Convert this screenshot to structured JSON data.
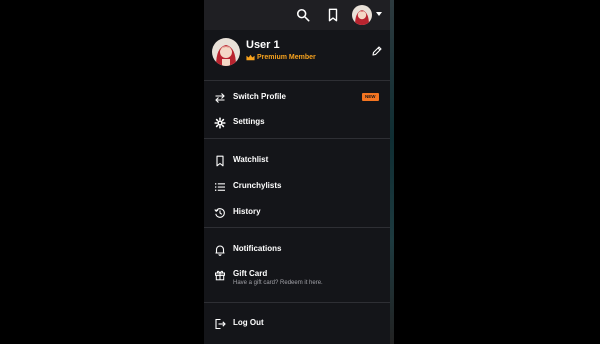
{
  "topbar": {
    "icons": [
      "search-icon",
      "bookmark-icon"
    ],
    "avatar": "user-avatar",
    "dropdown_icon": "caret-down-icon"
  },
  "profile": {
    "name": "User 1",
    "membership": "Premium Member",
    "membership_icon": "crown-icon",
    "edit_icon": "pencil-icon"
  },
  "menu": {
    "switch_profile": "Switch Profile",
    "new_badge": "NEW",
    "settings": "Settings",
    "watchlist": "Watchlist",
    "crunchylists": "Crunchylists",
    "history": "History",
    "notifications": "Notifications",
    "gift_card": "Gift Card",
    "gift_card_sub": "Have a gift card? Redeem it here.",
    "log_out": "Log Out"
  },
  "colors": {
    "accent": "#f47521",
    "premium": "#f7a21e",
    "background": "#141519",
    "topbar": "#1f1f23"
  }
}
